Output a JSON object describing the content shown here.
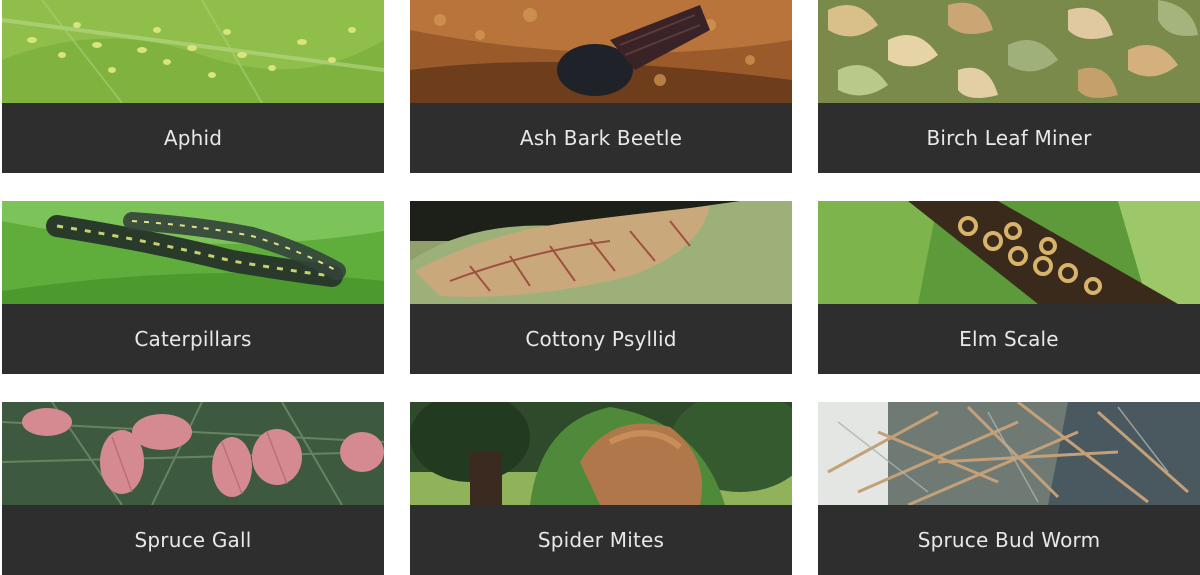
{
  "pests": [
    {
      "name": "Aphid",
      "image": "aphids-on-green-leaf-photo"
    },
    {
      "name": "Ash Bark Beetle",
      "image": "beetle-on-bark-photo"
    },
    {
      "name": "Birch Leaf Miner",
      "image": "damaged-birch-leaves-photo"
    },
    {
      "name": "Caterpillars",
      "image": "caterpillars-on-leaf-photo"
    },
    {
      "name": "Cottony Psyllid",
      "image": "curled-leaf-photo"
    },
    {
      "name": "Elm Scale",
      "image": "scale-insects-on-branch-photo"
    },
    {
      "name": "Spruce Gall",
      "image": "spruce-galls-photo"
    },
    {
      "name": "Spider Mites",
      "image": "mite-damaged-shrub-photo"
    },
    {
      "name": "Spruce Bud Worm",
      "image": "damaged-spruce-branches-photo"
    }
  ],
  "colors": {
    "caption_bg": "#2e2e2e",
    "caption_text": "#e8e8e8",
    "page_bg": "#ffffff"
  }
}
